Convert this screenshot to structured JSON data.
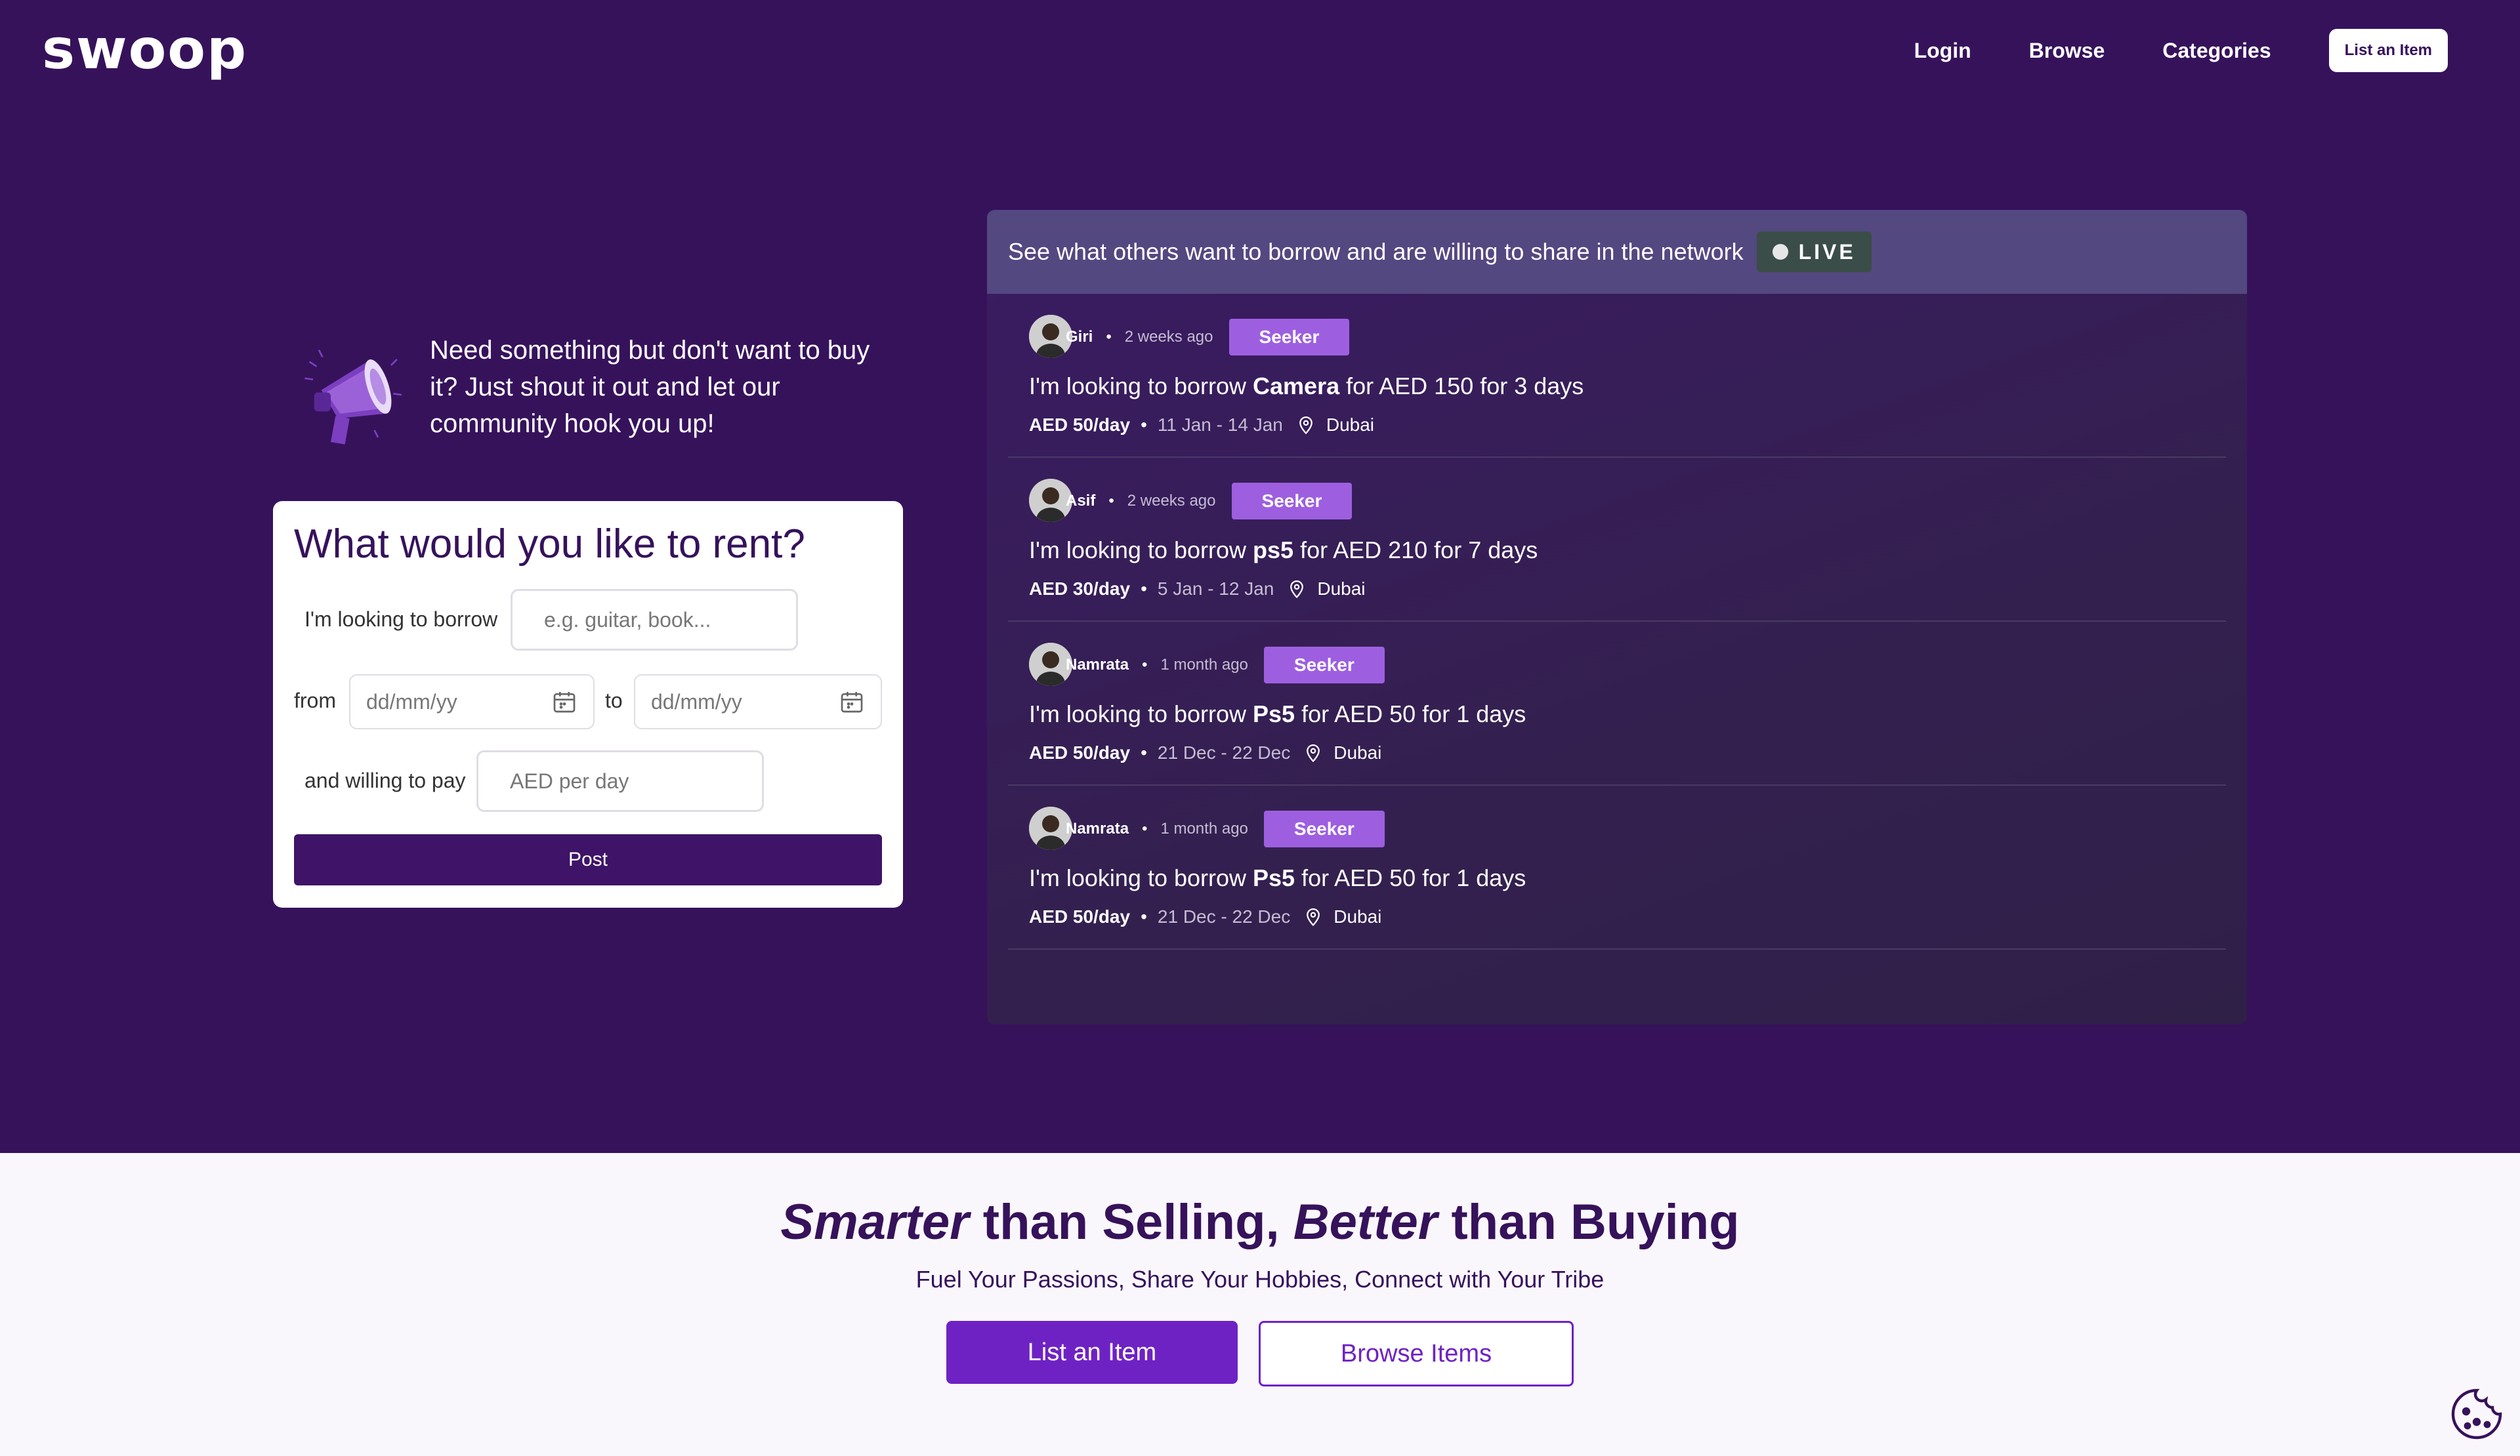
{
  "header": {
    "logo": "swoop",
    "nav": [
      "Login",
      "Browse",
      "Categories"
    ],
    "list_button": "List an Item"
  },
  "intro": {
    "text": "Need something but don't want to buy it? Just shout it out and let our community hook you up!"
  },
  "rent_form": {
    "title": "What would you like to rent?",
    "borrow_label": "I'm looking to borrow",
    "borrow_placeholder": "e.g. guitar, book...",
    "from_label": "from",
    "from_placeholder": "dd/mm/yy",
    "to_label": "to",
    "to_placeholder": "dd/mm/yy",
    "pay_label": "and willing to pay",
    "pay_placeholder": "AED per day",
    "post_button": "Post"
  },
  "feed": {
    "title": "See what others want to borrow and are willing to share in the network",
    "live_label": "LIVE",
    "items": [
      {
        "name": "Giri",
        "ago": "2 weeks ago",
        "badge": "Seeker",
        "prefix": "I'm looking to borrow ",
        "item": "Camera",
        "suffix": " for AED 150 for 3 days",
        "price": "AED 50/day",
        "dates": "11 Jan - 14 Jan",
        "location": "Dubai"
      },
      {
        "name": "Asif",
        "ago": "2 weeks ago",
        "badge": "Seeker",
        "prefix": "I'm looking to borrow ",
        "item": "ps5",
        "suffix": " for AED 210 for 7 days",
        "price": "AED 30/day",
        "dates": "5 Jan - 12 Jan",
        "location": "Dubai"
      },
      {
        "name": "Namrata",
        "ago": "1 month ago",
        "badge": "Seeker",
        "prefix": "I'm looking to borrow ",
        "item": "Ps5",
        "suffix": " for AED 50 for 1 days",
        "price": "AED 50/day",
        "dates": "21 Dec - 22 Dec",
        "location": "Dubai"
      },
      {
        "name": "Namrata",
        "ago": "1 month ago",
        "badge": "Seeker",
        "prefix": "I'm looking to borrow ",
        "item": "Ps5",
        "suffix": " for AED 50 for 1 days",
        "price": "AED 50/day",
        "dates": "21 Dec - 22 Dec",
        "location": "Dubai"
      }
    ]
  },
  "bottom": {
    "headline_em1": "Smarter",
    "headline_mid": " than Selling, ",
    "headline_em2": "Better",
    "headline_end": " than Buying",
    "tagline": "Fuel Your Passions, Share Your Hobbies, Connect with Your Tribe",
    "list_button": "List an Item",
    "browse_button": "Browse Items"
  },
  "colors": {
    "hero_bg": "#36125b",
    "accent": "#6f22c4",
    "seeker_badge": "#9d5fe0"
  }
}
